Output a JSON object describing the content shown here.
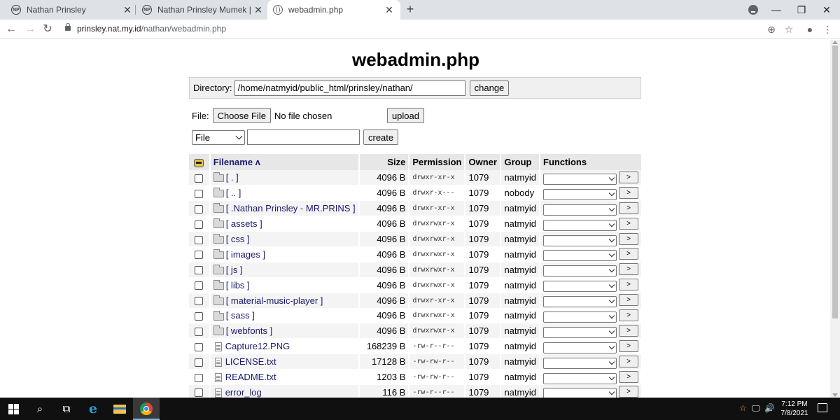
{
  "browser": {
    "tabs": [
      {
        "title": "Nathan Prinsley",
        "active": false
      },
      {
        "title": "Nathan Prinsley Mumek | Websit",
        "active": false
      },
      {
        "title": "webadmin.php",
        "active": true
      }
    ],
    "url_host": "prinsley.nat.my.id",
    "url_path": "/nathan/webadmin.php"
  },
  "page": {
    "title": "webadmin.php",
    "directory_label": "Directory:",
    "directory_value": "/home/natmyid/public_html/prinsley/nathan/",
    "change_label": "change",
    "file_label": "File:",
    "choose_file_label": "Choose File",
    "no_file_text": "No file chosen",
    "upload_label": "upload",
    "create_type_value": "File",
    "create_label": "create"
  },
  "table": {
    "headers": {
      "filename": "Filename ʌ",
      "size": "Size",
      "permission": "Permission",
      "owner": "Owner",
      "group": "Group",
      "functions": "Functions"
    },
    "go_label": ">",
    "rows": [
      {
        "type": "folder",
        "name": "[ . ]",
        "size": "4096 B",
        "perm": "drwxr-xr-x",
        "owner": "1079",
        "group": "natmyid"
      },
      {
        "type": "folder",
        "name": "[ .. ]",
        "size": "4096 B",
        "perm": "drwxr-x---",
        "owner": "1079",
        "group": "nobody"
      },
      {
        "type": "folder",
        "name": "[ .Nathan Prinsley - MR.PRINS ]",
        "size": "4096 B",
        "perm": "drwxr-xr-x",
        "owner": "1079",
        "group": "natmyid"
      },
      {
        "type": "folder",
        "name": "[ assets ]",
        "size": "4096 B",
        "perm": "drwxrwxr-x",
        "owner": "1079",
        "group": "natmyid"
      },
      {
        "type": "folder",
        "name": "[ css ]",
        "size": "4096 B",
        "perm": "drwxrwxr-x",
        "owner": "1079",
        "group": "natmyid"
      },
      {
        "type": "folder",
        "name": "[ images ]",
        "size": "4096 B",
        "perm": "drwxrwxr-x",
        "owner": "1079",
        "group": "natmyid"
      },
      {
        "type": "folder",
        "name": "[ js ]",
        "size": "4096 B",
        "perm": "drwxrwxr-x",
        "owner": "1079",
        "group": "natmyid"
      },
      {
        "type": "folder",
        "name": "[ libs ]",
        "size": "4096 B",
        "perm": "drwxrwxr-x",
        "owner": "1079",
        "group": "natmyid"
      },
      {
        "type": "folder",
        "name": "[ material-music-player ]",
        "size": "4096 B",
        "perm": "drwxr-xr-x",
        "owner": "1079",
        "group": "natmyid"
      },
      {
        "type": "folder",
        "name": "[ sass ]",
        "size": "4096 B",
        "perm": "drwxrwxr-x",
        "owner": "1079",
        "group": "natmyid"
      },
      {
        "type": "folder",
        "name": "[ webfonts ]",
        "size": "4096 B",
        "perm": "drwxrwxr-x",
        "owner": "1079",
        "group": "natmyid"
      },
      {
        "type": "file",
        "name": "Capture12.PNG",
        "size": "168239 B",
        "perm": "-rw-r--r--",
        "owner": "1079",
        "group": "natmyid"
      },
      {
        "type": "file",
        "name": "LICENSE.txt",
        "size": "17128 B",
        "perm": "-rw-rw-r--",
        "owner": "1079",
        "group": "natmyid"
      },
      {
        "type": "file",
        "name": "README.txt",
        "size": "1203 B",
        "perm": "-rw-rw-r--",
        "owner": "1079",
        "group": "natmyid"
      },
      {
        "type": "file",
        "name": "error_log",
        "size": "116 B",
        "perm": "-rw-r--r--",
        "owner": "1079",
        "group": "natmyid"
      }
    ]
  },
  "taskbar": {
    "time": "7:12 PM",
    "date": "7/8/2021"
  }
}
